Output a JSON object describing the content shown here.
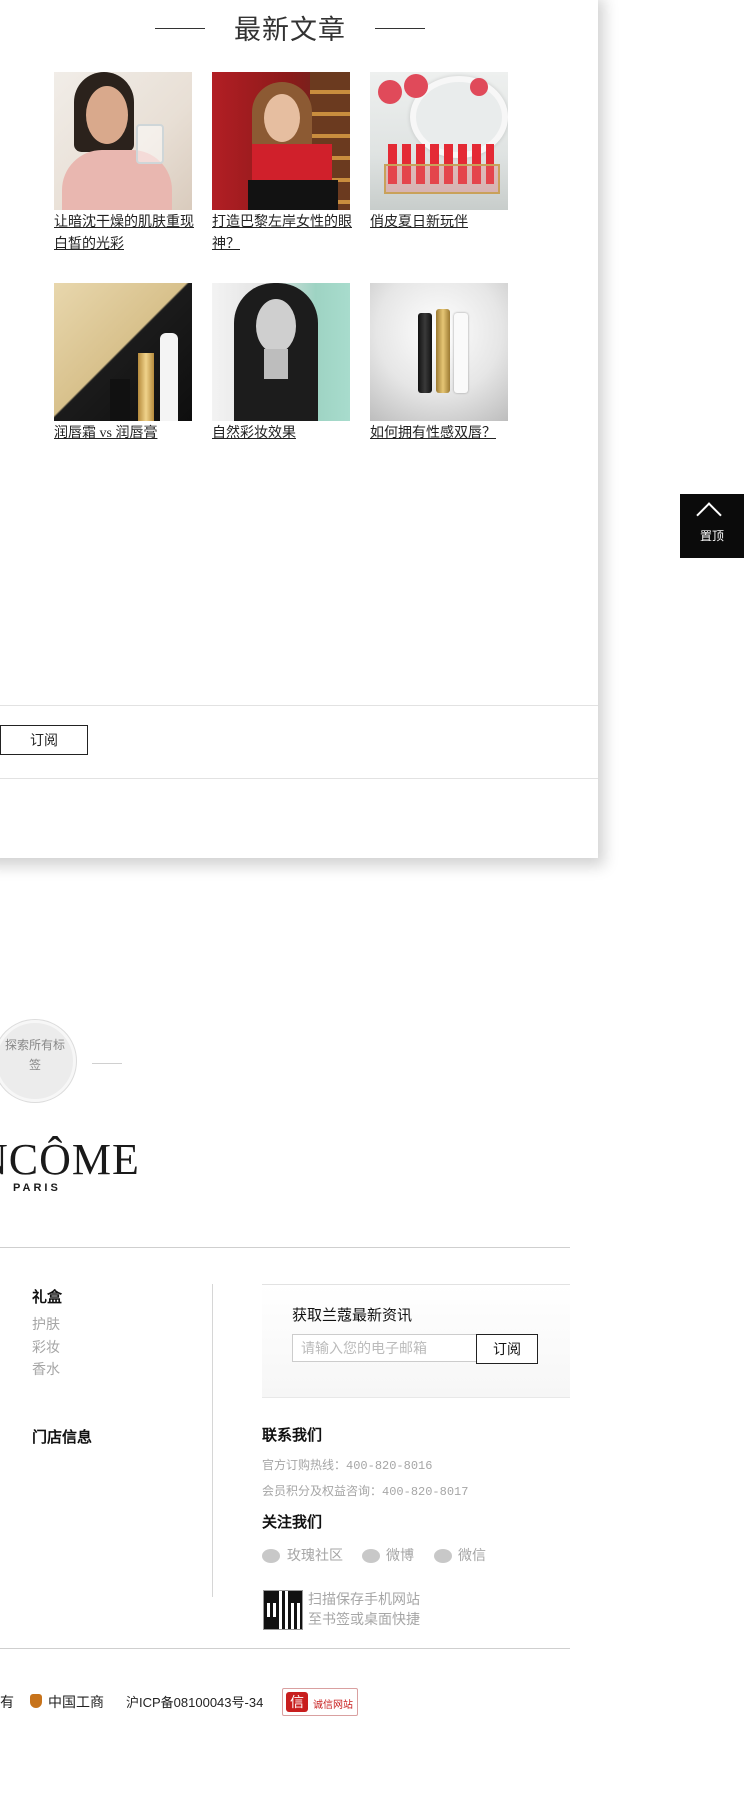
{
  "latest": {
    "title": "最新文章",
    "articles": [
      {
        "caption": "让暗沈干燥的肌肤重现白皙的光彩"
      },
      {
        "caption": "打造巴黎左岸女性的眼神？"
      },
      {
        "caption": "俏皮夏日新玩伴"
      },
      {
        "caption": "润唇霜 vs 润唇膏"
      },
      {
        "caption": "自然彩妆效果"
      },
      {
        "caption": "如何拥有性感双唇？"
      }
    ],
    "subscribe_label": "订阅"
  },
  "back_to_top": {
    "label": "置顶",
    "icon": "chevron-up-icon"
  },
  "explore": {
    "label": "探索所有标签"
  },
  "brand": {
    "logo": "NCÔME",
    "sub": "PARIS"
  },
  "footer": {
    "col1": {
      "heading": "礼盒",
      "links": [
        "护肤",
        "彩妆",
        "香水"
      ],
      "store_heading": "门店信息"
    },
    "newsletter": {
      "title": "获取兰蔻最新资讯",
      "placeholder": "请输入您的电子邮箱",
      "button": "订阅"
    },
    "contact": {
      "heading": "联系我们",
      "hotline_label": "官方订购热线：",
      "hotline": "400-820-8016",
      "member_label": "会员积分及权益咨询：",
      "member": "400-820-8017"
    },
    "follow": {
      "heading": "关注我们",
      "items": [
        {
          "label": "玫瑰社区",
          "icon": "rose-icon"
        },
        {
          "label": "微博",
          "icon": "weibo-icon"
        },
        {
          "label": "微信",
          "icon": "wechat-icon"
        }
      ]
    },
    "qr": {
      "line1": "扫描保存手机网站",
      "line2": "至书签或桌面快捷"
    },
    "bottom": {
      "left": "有",
      "gongshang": "中国工商",
      "icp": "沪ICP备08100043号-34",
      "credit_icon": "信",
      "credit": "诚信网站"
    }
  }
}
